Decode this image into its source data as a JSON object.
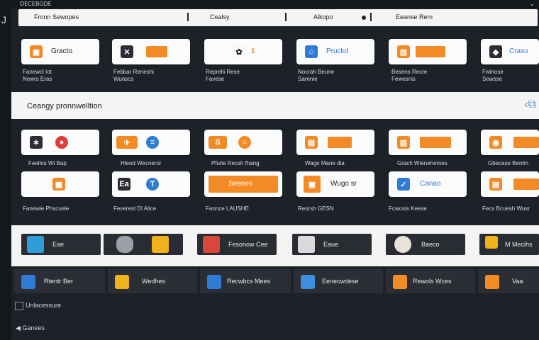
{
  "topbar": {
    "title": "DECEBODE"
  },
  "tabbar": {
    "items": [
      "Fronn Sewopes",
      "Cealsy",
      "Alkopo",
      "Eeanse Rem"
    ]
  },
  "apps": {
    "items": [
      {
        "label": "Gracto",
        "caption1": "Fanewcl Iot",
        "caption2": "Newrs Eras"
      },
      {
        "label": "",
        "caption1": "Febbar Reneshi",
        "caption2": "Wunscs"
      },
      {
        "label": "1",
        "caption1": "Reprelli Rese",
        "caption2": "Favese"
      },
      {
        "label": "Pruckd",
        "caption1": "Nocrah Beune",
        "caption2": "Sarenie"
      },
      {
        "label": "",
        "caption1": "Besens Recre",
        "caption2": "Fewesnis"
      },
      {
        "label": "Craso",
        "caption1": "Fwinose",
        "caption2": "Sewsse"
      }
    ]
  },
  "category": {
    "title": "Ceangy pronnwelltion"
  },
  "grid": {
    "row1": [
      {
        "caption": "Feelins Wi Bap"
      },
      {
        "caption": "Hleod Wecnerol"
      },
      {
        "caption": "Pfutie Recsh fhang"
      },
      {
        "caption": "Wage Mane dia"
      },
      {
        "caption": "Grach Wienehemes"
      },
      {
        "caption": "Gbecase Benlm"
      }
    ],
    "row2": [
      {
        "label": "",
        "caption": "Fanewie Phscuele"
      },
      {
        "label": "Ea",
        "caption": "Feverest Dl Alice"
      },
      {
        "label": "Seenes",
        "caption": "Fannce LAUSHE"
      },
      {
        "label": "Wugo sr",
        "caption": "Reorsh GESN"
      },
      {
        "label": "Canao",
        "caption": "Fcwosis Keese"
      },
      {
        "label": "",
        "caption": "Fecs Bcuesh Wusr"
      }
    ]
  },
  "rail": {
    "items": [
      {
        "label": "Eae"
      },
      {
        "label": ""
      },
      {
        "label": "Fesonow Cee"
      },
      {
        "label": "Eaue"
      },
      {
        "label": "Baeco"
      },
      {
        "label": "M Mecihs"
      }
    ]
  },
  "strip": {
    "items": [
      {
        "label": "Rtentr Ber"
      },
      {
        "label": "Wedhes"
      },
      {
        "label": "Recwbcs Mees"
      },
      {
        "label": "Eenecwdese"
      },
      {
        "label": "Rewols Wces"
      },
      {
        "label": "Vaa"
      }
    ]
  },
  "misc": {
    "checkbox": "Unlacessure",
    "footer": "Ganees"
  }
}
